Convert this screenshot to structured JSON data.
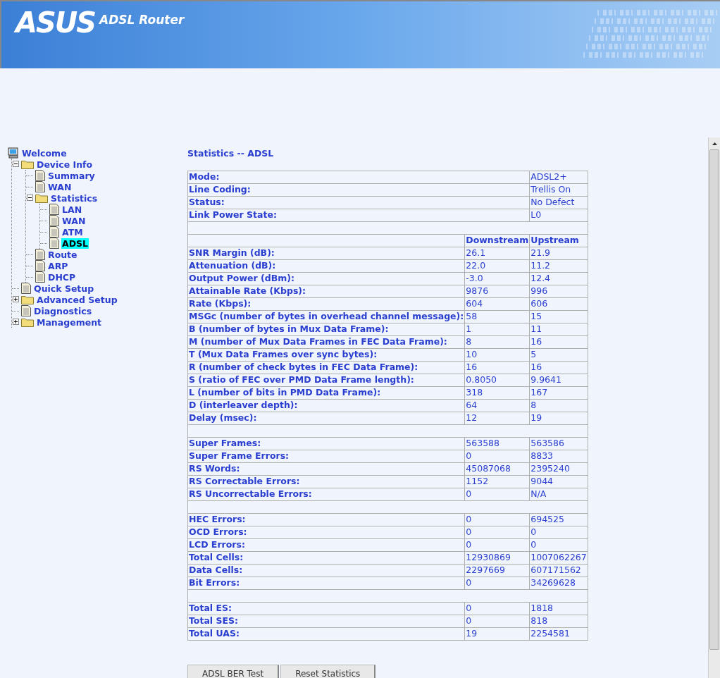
{
  "header": {
    "logo": "ASUS",
    "product": "ADSL Router"
  },
  "tree": [
    {
      "label": "Welcome",
      "kind": "computer",
      "selected": false,
      "children": [
        {
          "label": "Device Info",
          "kind": "folder",
          "expanded": true,
          "selected": false,
          "children": [
            {
              "label": "Summary",
              "kind": "page",
              "selected": false
            },
            {
              "label": "WAN",
              "kind": "page",
              "selected": false
            },
            {
              "label": "Statistics",
              "kind": "folder",
              "expanded": true,
              "selected": false,
              "children": [
                {
                  "label": "LAN",
                  "kind": "page",
                  "selected": false
                },
                {
                  "label": "WAN",
                  "kind": "page",
                  "selected": false
                },
                {
                  "label": "ATM",
                  "kind": "page",
                  "selected": false
                },
                {
                  "label": "ADSL",
                  "kind": "page",
                  "selected": true
                }
              ]
            },
            {
              "label": "Route",
              "kind": "page",
              "selected": false
            },
            {
              "label": "ARP",
              "kind": "page",
              "selected": false
            },
            {
              "label": "DHCP",
              "kind": "page",
              "selected": false
            }
          ]
        },
        {
          "label": "Quick Setup",
          "kind": "page",
          "selected": false
        },
        {
          "label": "Advanced Setup",
          "kind": "folder",
          "expanded": false,
          "selected": false
        },
        {
          "label": "Diagnostics",
          "kind": "page",
          "selected": false
        },
        {
          "label": "Management",
          "kind": "folder",
          "expanded": false,
          "selected": false
        }
      ]
    }
  ],
  "title": "Statistics -- ADSL",
  "summary": [
    {
      "label": "Mode:",
      "value": "ADSL2+"
    },
    {
      "label": "Line Coding:",
      "value": "Trellis On"
    },
    {
      "label": "Status:",
      "value": "No Defect"
    },
    {
      "label": "Link Power State:",
      "value": "L0"
    }
  ],
  "columns": [
    "Downstream",
    "Upstream"
  ],
  "groups": [
    [
      {
        "label": "SNR Margin (dB):",
        "down": "26.1",
        "up": "21.9"
      },
      {
        "label": "Attenuation (dB):",
        "down": "22.0",
        "up": "11.2"
      },
      {
        "label": "Output Power (dBm):",
        "down": "-3.0",
        "up": "12.4"
      },
      {
        "label": "Attainable Rate (Kbps):",
        "down": "9876",
        "up": "996"
      },
      {
        "label": "Rate (Kbps):",
        "down": "604",
        "up": "606"
      },
      {
        "label": "MSGc (number of bytes in overhead channel message):",
        "down": "58",
        "up": "15"
      },
      {
        "label": "B (number of bytes in Mux Data Frame):",
        "down": "1",
        "up": "11"
      },
      {
        "label": "M (number of Mux Data Frames in FEC Data Frame):",
        "down": "8",
        "up": "16"
      },
      {
        "label": "T (Mux Data Frames over sync bytes):",
        "down": "10",
        "up": "5"
      },
      {
        "label": "R (number of check bytes in FEC Data Frame):",
        "down": "16",
        "up": "16"
      },
      {
        "label": "S (ratio of FEC over PMD Data Frame length):",
        "down": "0.8050",
        "up": "9.9641"
      },
      {
        "label": "L (number of bits in PMD Data Frame):",
        "down": "318",
        "up": "167"
      },
      {
        "label": "D (interleaver depth):",
        "down": "64",
        "up": "8"
      },
      {
        "label": "Delay (msec):",
        "down": "12",
        "up": "19"
      }
    ],
    [
      {
        "label": "Super Frames:",
        "down": "563588",
        "up": "563586"
      },
      {
        "label": "Super Frame Errors:",
        "down": "0",
        "up": "8833"
      },
      {
        "label": "RS Words:",
        "down": "45087068",
        "up": "2395240"
      },
      {
        "label": "RS Correctable Errors:",
        "down": "1152",
        "up": "9044"
      },
      {
        "label": "RS Uncorrectable Errors:",
        "down": "0",
        "up": "N/A"
      }
    ],
    [
      {
        "label": "HEC Errors:",
        "down": "0",
        "up": "694525"
      },
      {
        "label": "OCD Errors:",
        "down": "0",
        "up": "0"
      },
      {
        "label": "LCD Errors:",
        "down": "0",
        "up": "0"
      },
      {
        "label": "Total Cells:",
        "down": "12930869",
        "up": "1007062267"
      },
      {
        "label": "Data Cells:",
        "down": "2297669",
        "up": "607171562"
      },
      {
        "label": "Bit Errors:",
        "down": "0",
        "up": "34269628"
      }
    ],
    [
      {
        "label": "Total ES:",
        "down": "0",
        "up": "1818"
      },
      {
        "label": "Total SES:",
        "down": "0",
        "up": "818"
      },
      {
        "label": "Total UAS:",
        "down": "19",
        "up": "2254581"
      }
    ]
  ],
  "buttons": [
    "ADSL BER Test",
    "Reset Statistics"
  ]
}
